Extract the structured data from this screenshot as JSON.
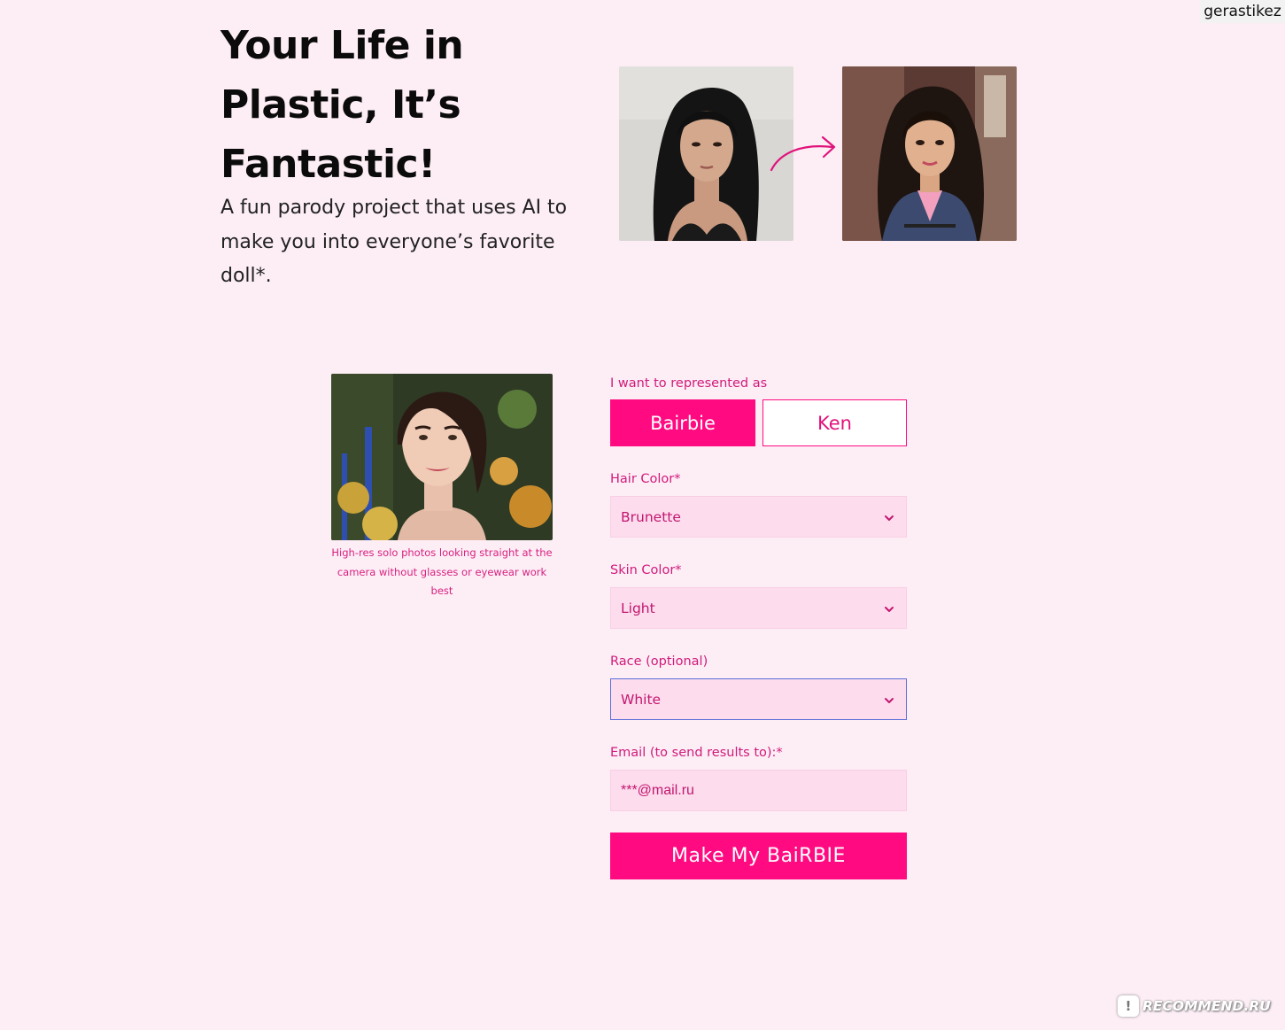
{
  "watermark_user": "gerastikez",
  "hero": {
    "title": "Your Life in Plastic, It’s Fantastic!",
    "subtitle": "A fun parody project that uses AI to make you into everyone’s favorite doll*."
  },
  "upload": {
    "hint": "High-res solo photos looking straight at the camera without glasses or eyewear work best"
  },
  "form": {
    "represent_label": "I want to represented as",
    "options": [
      "Bairbie",
      "Ken"
    ],
    "selected_option": "Bairbie",
    "hair_label": "Hair Color*",
    "hair_value": "Brunette",
    "skin_label": "Skin Color*",
    "skin_value": "Light",
    "race_label": "Race (optional)",
    "race_value": "White",
    "email_label": "Email (to send results to):*",
    "email_value": "***@mail.ru",
    "submit_label": "Make My BaiRBIE"
  },
  "footer_watermark": "RECOMMEND.RU",
  "colors": {
    "background": "#fdeef6",
    "accent": "#ff0a80",
    "label": "#d11a7a",
    "field_bg": "#fddcee",
    "focus_border": "#5b6fd8"
  },
  "icons": [
    "arrow-right-curved-icon",
    "chevron-down-icon",
    "recommend-logo-icon"
  ]
}
